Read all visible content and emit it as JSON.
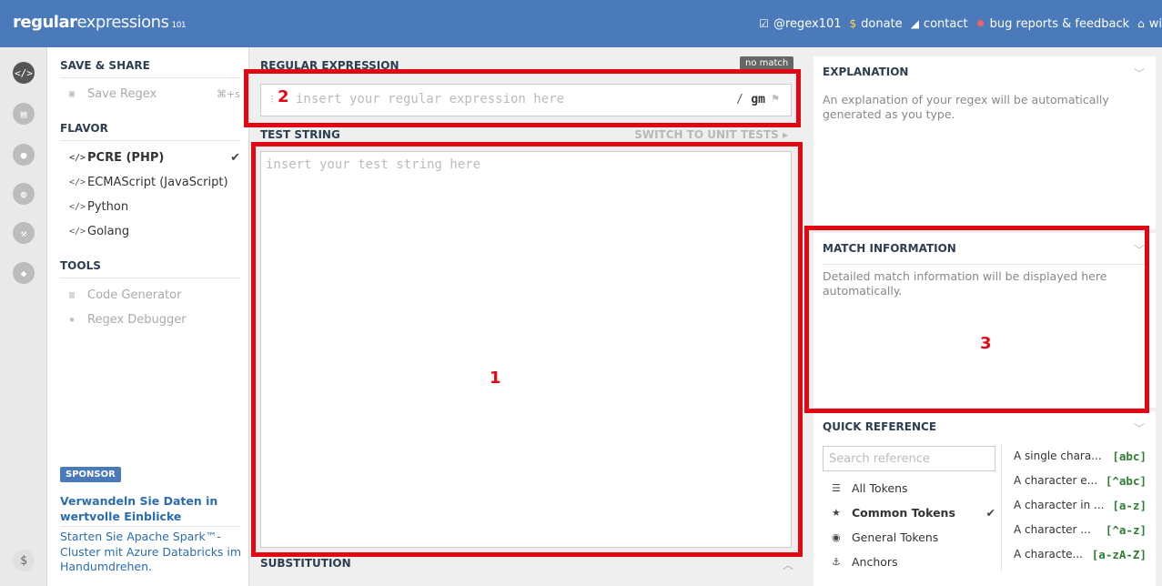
{
  "header": {
    "logo_regular": "regular",
    "logo_expressions": "expressions",
    "logo_version": "101",
    "nav": [
      {
        "icon": "twitter-icon",
        "label": "@regex101"
      },
      {
        "icon": "dollar-icon",
        "label": "donate"
      },
      {
        "icon": "paper-plane-icon",
        "label": "contact"
      },
      {
        "icon": "bug-icon",
        "label": "bug reports & feedback"
      },
      {
        "icon": "bank-icon",
        "label": "wi"
      }
    ]
  },
  "sidebar_icons": [
    "code-icon",
    "book-icon",
    "user-icon",
    "gamepad-icon",
    "wrench-icon",
    "chat-icon",
    "dollar-icon"
  ],
  "left_menu": {
    "save_share": {
      "title": "SAVE & SHARE",
      "save_label": "Save Regex",
      "save_shortcut": "⌘+s"
    },
    "flavor": {
      "title": "FLAVOR",
      "items": [
        {
          "label": "PCRE (PHP)",
          "selected": true
        },
        {
          "label": "ECMAScript (JavaScript)",
          "selected": false
        },
        {
          "label": "Python",
          "selected": false
        },
        {
          "label": "Golang",
          "selected": false
        }
      ]
    },
    "tools": {
      "title": "TOOLS",
      "items": [
        {
          "label": "Code Generator"
        },
        {
          "label": "Regex Debugger"
        }
      ]
    },
    "sponsor": {
      "badge": "SPONSOR",
      "title": "Verwandeln Sie Daten in wertvolle Einblicke",
      "text": "Starten Sie Apache Spark™-Cluster mit Azure Databricks im Handumdrehen."
    }
  },
  "regex_panel": {
    "title": "REGULAR EXPRESSION",
    "status": "no match",
    "placeholder": "insert your regular expression here",
    "delimiter": "/",
    "flags": "gm"
  },
  "test_panel": {
    "title": "TEST STRING",
    "switch_label": "SWITCH TO UNIT TESTS",
    "placeholder": "insert your test string here"
  },
  "substitution": {
    "title": "SUBSTITUTION"
  },
  "explanation": {
    "title": "EXPLANATION",
    "body": "An explanation of your regex will be automatically generated as you type."
  },
  "match_info": {
    "title": "MATCH INFORMATION",
    "body": "Detailed match information will be displayed here automatically."
  },
  "quick_reference": {
    "title": "QUICK REFERENCE",
    "search_placeholder": "Search reference",
    "categories": [
      {
        "icon": "database-icon",
        "label": "All Tokens",
        "selected": false
      },
      {
        "icon": "star-icon",
        "label": "Common Tokens",
        "selected": true
      },
      {
        "icon": "target-icon",
        "label": "General Tokens",
        "selected": false
      },
      {
        "icon": "anchor-icon",
        "label": "Anchors",
        "selected": false
      }
    ],
    "tokens": [
      {
        "desc": "A single chara...",
        "token": "[abc]"
      },
      {
        "desc": "A character e...",
        "token": "[^abc]"
      },
      {
        "desc": "A character in ...",
        "token": "[a-z]"
      },
      {
        "desc": "A character ...",
        "token": "[^a-z]"
      },
      {
        "desc": "A characte...",
        "token": "[a-zA-Z]"
      }
    ]
  },
  "annotations": [
    {
      "label": "1"
    },
    {
      "label": "2"
    },
    {
      "label": "3"
    }
  ]
}
